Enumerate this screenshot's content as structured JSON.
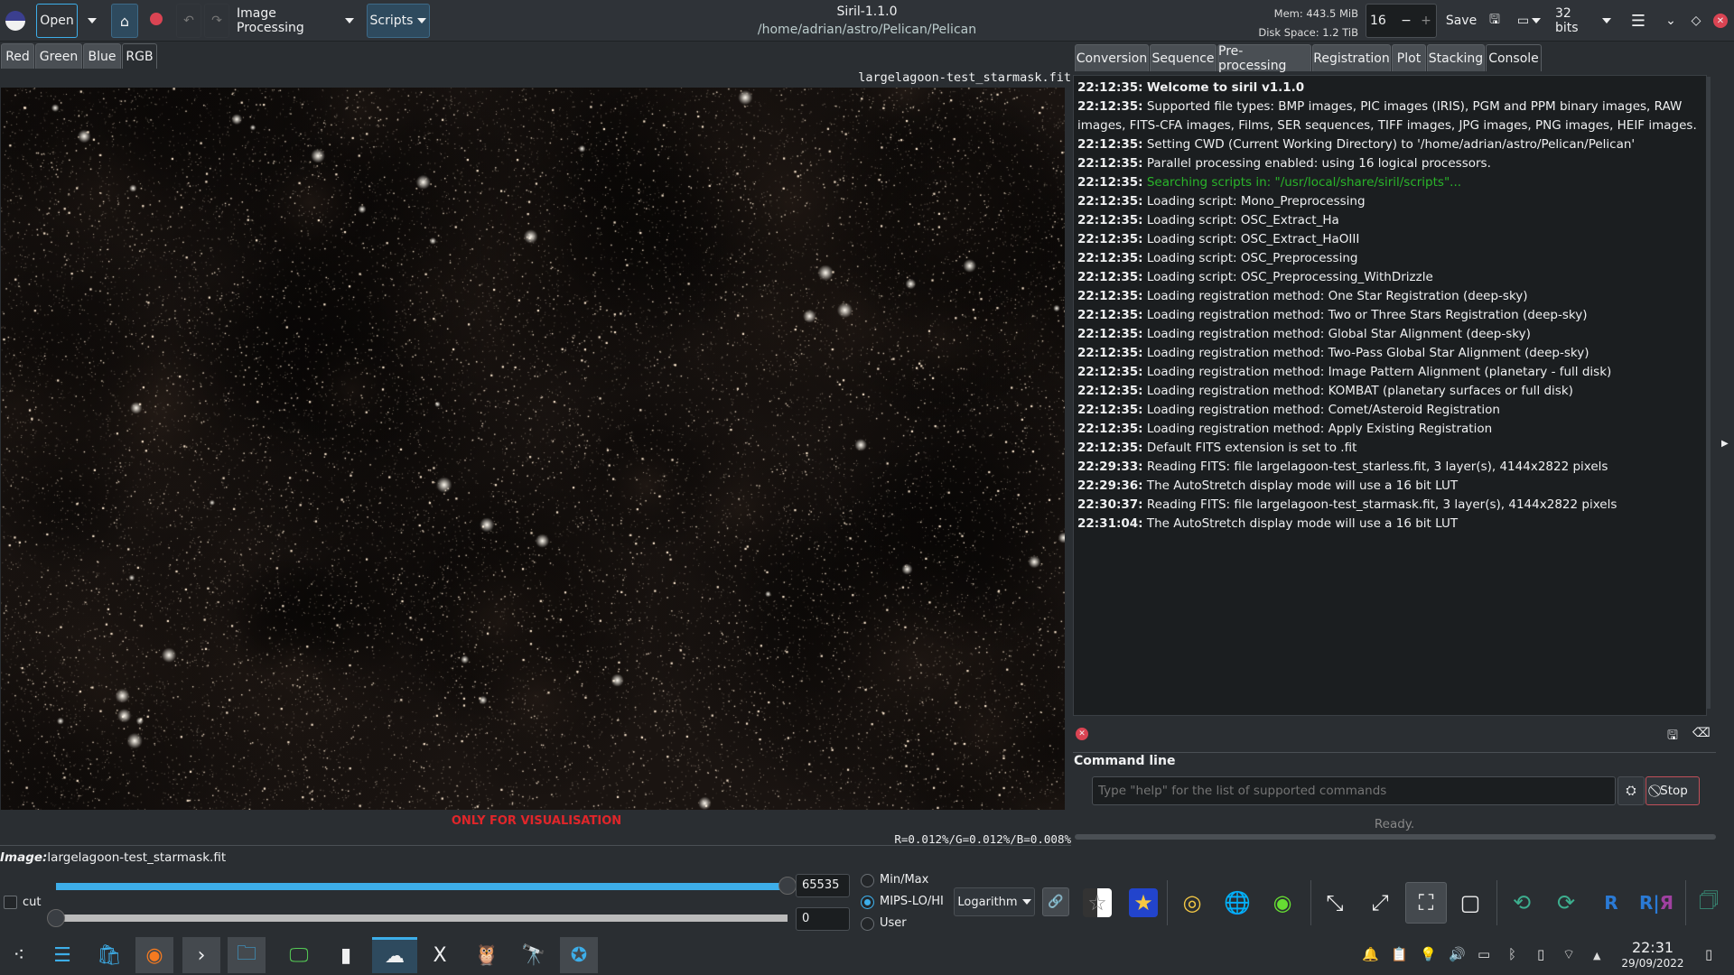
{
  "window": {
    "title": "Siril-1.1.0",
    "path": "/home/adrian/astro/Pelican/Pelican"
  },
  "toolbar": {
    "open": "Open",
    "image_processing": "Image Processing",
    "scripts": "Scripts",
    "mem": "Mem: 443.5 MiB",
    "disk": "Disk Space: 1.2 TiB",
    "threads": "16",
    "save": "Save",
    "bits": "32 bits"
  },
  "channel_tabs": [
    "Red",
    "Green",
    "Blue",
    "RGB"
  ],
  "active_channel": "RGB",
  "image": {
    "filename": "largelagoon-test_starmask.fit",
    "warning": "ONLY FOR VISUALISATION",
    "pixel_readout": "R=0.012%/G=0.012%/B=0.008%",
    "label_prefix": "Image:",
    "label_value": "largelagoon-test_starmask.fit"
  },
  "right_tabs": [
    "Conversion",
    "Sequence",
    "Pre-processing",
    "Registration",
    "Plot",
    "Stacking",
    "Console"
  ],
  "active_right_tab": "Console",
  "console": [
    {
      "ts": "22:12:35:",
      "msg": "Welcome to siril v1.1.0",
      "bold": true
    },
    {
      "ts": "22:12:35:",
      "msg": "Supported file types: BMP images, PIC images (IRIS), PGM and PPM binary images, RAW images, FITS-CFA images, Films, SER sequences, TIFF images, JPG images, PNG images, HEIF images."
    },
    {
      "ts": "22:12:35:",
      "msg": "Setting CWD (Current Working Directory) to '/home/adrian/astro/Pelican/Pelican'"
    },
    {
      "ts": "22:12:35:",
      "msg": "Parallel processing enabled: using 16 logical processors."
    },
    {
      "ts": "22:12:35:",
      "msg": "Searching scripts in: \"/usr/local/share/siril/scripts\"...",
      "color": "#2ab52a"
    },
    {
      "ts": "22:12:35:",
      "msg": "Loading script: Mono_Preprocessing"
    },
    {
      "ts": "22:12:35:",
      "msg": "Loading script: OSC_Extract_Ha"
    },
    {
      "ts": "22:12:35:",
      "msg": "Loading script: OSC_Extract_HaOIII"
    },
    {
      "ts": "22:12:35:",
      "msg": "Loading script: OSC_Preprocessing"
    },
    {
      "ts": "22:12:35:",
      "msg": "Loading script: OSC_Preprocessing_WithDrizzle"
    },
    {
      "ts": "22:12:35:",
      "msg": "Loading registration method: One Star Registration (deep-sky)"
    },
    {
      "ts": "22:12:35:",
      "msg": "Loading registration method: Two or Three Stars Registration (deep-sky)"
    },
    {
      "ts": "22:12:35:",
      "msg": "Loading registration method: Global Star Alignment (deep-sky)"
    },
    {
      "ts": "22:12:35:",
      "msg": "Loading registration method: Two-Pass Global Star Alignment (deep-sky)"
    },
    {
      "ts": "22:12:35:",
      "msg": "Loading registration method: Image Pattern Alignment (planetary - full disk)"
    },
    {
      "ts": "22:12:35:",
      "msg": "Loading registration method: KOMBAT (planetary surfaces or full disk)"
    },
    {
      "ts": "22:12:35:",
      "msg": "Loading registration method: Comet/Asteroid Registration"
    },
    {
      "ts": "22:12:35:",
      "msg": "Loading registration method: Apply Existing Registration"
    },
    {
      "ts": "22:12:35:",
      "msg": "Default FITS extension is set to .fit"
    },
    {
      "ts": "22:29:33:",
      "msg": "Reading FITS: file largelagoon-test_starless.fit, 3 layer(s), 4144x2822 pixels"
    },
    {
      "ts": "22:29:36:",
      "msg": "The AutoStretch display mode will use a 16 bit LUT"
    },
    {
      "ts": "22:30:37:",
      "msg": "Reading FITS: file largelagoon-test_starmask.fit, 3 layer(s), 4144x2822 pixels"
    },
    {
      "ts": "22:31:04:",
      "msg": "The AutoStretch display mode will use a 16 bit LUT"
    }
  ],
  "command": {
    "label": "Command line",
    "placeholder": "Type \"help\" for the list of supported commands",
    "stop": "Stop",
    "status": "Ready."
  },
  "display": {
    "hi_value": "65535",
    "lo_value": "0",
    "hi_fraction": 1.0,
    "lo_fraction": 0.0,
    "cut_label": "cut",
    "modes": [
      "Min/Max",
      "MIPS-LO/HI",
      "User"
    ],
    "selected_mode": "MIPS-LO/HI",
    "stretch": "Logarithm"
  },
  "taskbar": {
    "time": "22:31",
    "date": "29/09/2022"
  },
  "colors": {
    "accent": "#3daee9",
    "warning": "#e0262a",
    "close": "#da4453"
  }
}
